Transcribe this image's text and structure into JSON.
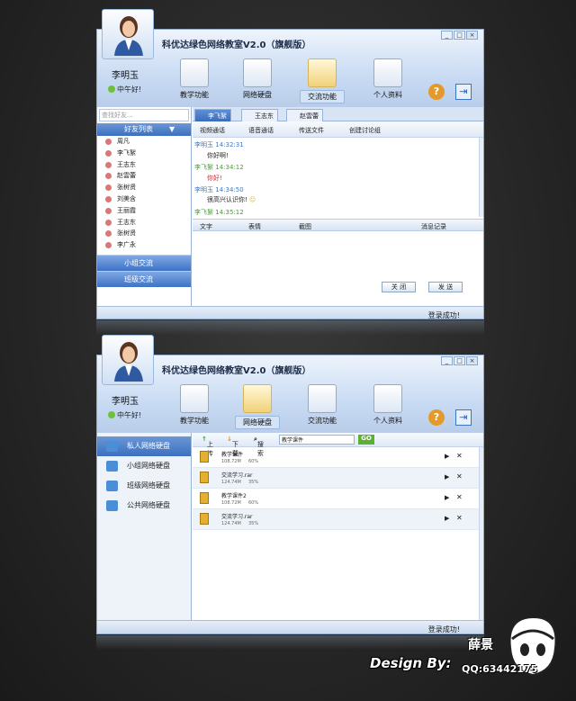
{
  "app_title": "科优达绿色网络教室V2.0（旗舰版）",
  "window_controls": [
    "_",
    "□",
    "×"
  ],
  "user": {
    "name": "李明玉",
    "status": "中午好!"
  },
  "nav": [
    {
      "label": "教学功能",
      "icon": "snowflake-icon"
    },
    {
      "label": "网络硬盘",
      "icon": "disc-icon"
    },
    {
      "label": "交流功能",
      "icon": "chat-bubble-icon"
    },
    {
      "label": "个人资料",
      "icon": "contact-card-icon"
    }
  ],
  "chat_window": {
    "search_placeholder": "查找好友...",
    "friends_header": "好友列表",
    "friends": [
      "周凡",
      "李飞絮",
      "王志东",
      "赵雲蕾",
      "张树贤",
      "刘美含",
      "王丽霞",
      "王志东",
      "张树贤",
      "李广永"
    ],
    "groups": [
      "小组交流",
      "班级交流"
    ],
    "tabs": [
      "李飞絮",
      "王志东",
      "赵雲蕾"
    ],
    "toolbar": [
      "视频通话",
      "语音通话",
      "传送文件",
      "创建讨论组"
    ],
    "messages": [
      {
        "sender": "李明玉",
        "time": "14:32:31",
        "text": "你好啊!"
      },
      {
        "sender": "李飞絮",
        "time": "14:34:12",
        "text": "你好!"
      },
      {
        "sender": "李明玉",
        "time": "14:34:50",
        "text": "很高兴认识你!"
      },
      {
        "sender": "李飞絮",
        "time": "14:35:12",
        "text": ""
      }
    ],
    "input_tools": [
      "文字",
      "表情",
      "截图"
    ],
    "history_label": "消息记录",
    "close_button": "关 闭",
    "send_button": "发 送",
    "status_text": "登录成功!"
  },
  "disk_window": {
    "sidebar": [
      "私人网络硬盘",
      "小组网络硬盘",
      "班级网络硬盘",
      "公共网络硬盘"
    ],
    "toolbar": {
      "upload": "上传",
      "download": "下载",
      "search": "搜索",
      "search_value": "教学课件",
      "go": "GO"
    },
    "files": [
      {
        "name": "教学课件",
        "size": "108.72M",
        "progress": "60%"
      },
      {
        "name": "交流学习.rar",
        "size": "124.74M",
        "progress": "35%"
      },
      {
        "name": "教学课件2",
        "size": "108.72M",
        "progress": "60%"
      },
      {
        "name": "交流学习.rar",
        "size": "124.74M",
        "progress": "35%"
      }
    ],
    "status_text": "登录成功!"
  },
  "credit": {
    "design": "Design By:",
    "name": "薛景",
    "qq": "QQ:63442175"
  }
}
